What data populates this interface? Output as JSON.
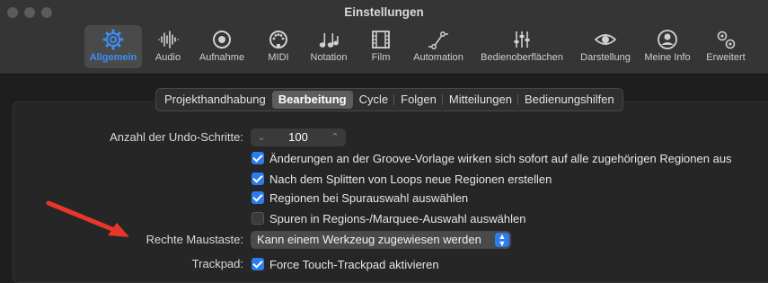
{
  "window": {
    "title": "Einstellungen"
  },
  "toolbar": {
    "items": [
      {
        "label": "Allgemein",
        "icon": "gear-icon",
        "active": true
      },
      {
        "label": "Audio",
        "icon": "waveform-icon"
      },
      {
        "label": "Aufnahme",
        "icon": "record-icon"
      },
      {
        "label": "MIDI",
        "icon": "midi-icon"
      },
      {
        "label": "Notation",
        "icon": "music-notes-icon"
      },
      {
        "label": "Film",
        "icon": "film-icon"
      },
      {
        "label": "Automation",
        "icon": "automation-icon"
      },
      {
        "label": "Bedienoberflächen",
        "icon": "sliders-icon"
      },
      {
        "label": "Darstellung",
        "icon": "eye-icon"
      },
      {
        "label": "Meine Info",
        "icon": "person-icon"
      },
      {
        "label": "Erweitert",
        "icon": "gears-icon"
      }
    ]
  },
  "tabs": [
    {
      "label": "Projekthandhabung"
    },
    {
      "label": "Bearbeitung",
      "selected": true
    },
    {
      "label": "Cycle"
    },
    {
      "label": "Folgen"
    },
    {
      "label": "Mitteilungen"
    },
    {
      "label": "Bedienungshilfen"
    }
  ],
  "settings": {
    "undo_label": "Anzahl der Undo-Schritte:",
    "undo_value": "100",
    "options": [
      {
        "label": "Änderungen an der Groove-Vorlage wirken sich sofort auf alle zugehörigen Regionen aus",
        "checked": true
      },
      {
        "label": "Nach dem Splitten von Loops neue Regionen erstellen",
        "checked": true
      },
      {
        "label": "Regionen bei Spurauswahl auswählen",
        "checked": true
      },
      {
        "label": "Spuren in Regions-/Marquee-Auswahl auswählen",
        "checked": false
      }
    ],
    "right_mouse_label": "Rechte Maustaste:",
    "right_mouse_value": "Kann einem Werkzeug zugewiesen werden",
    "trackpad_label": "Trackpad:",
    "trackpad_option": "Force Touch-Trackpad aktivieren"
  },
  "colors": {
    "accent": "#2b7cf0",
    "annotation_arrow": "#e8372a"
  }
}
